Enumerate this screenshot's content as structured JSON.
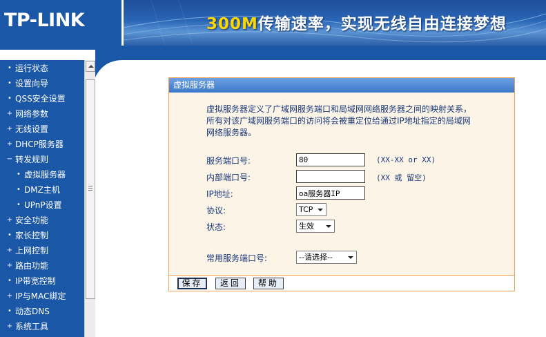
{
  "header": {
    "logo": "TP-LINK",
    "slogan_highlight": "300M",
    "slogan_rest": "传输速率，实现无线自由连接梦想"
  },
  "sidebar": {
    "items": [
      {
        "label": "运行状态",
        "bullet": "•",
        "level": 1
      },
      {
        "label": "设置向导",
        "bullet": "•",
        "level": 1
      },
      {
        "label": "QSS安全设置",
        "bullet": "•",
        "level": 1
      },
      {
        "label": "网络参数",
        "bullet": "+",
        "level": 1
      },
      {
        "label": "无线设置",
        "bullet": "+",
        "level": 1
      },
      {
        "label": "DHCP服务器",
        "bullet": "+",
        "level": 1
      },
      {
        "label": "转发规则",
        "bullet": "−",
        "level": 1
      },
      {
        "label": "虚拟服务器",
        "bullet": "•",
        "level": 2
      },
      {
        "label": "DMZ主机",
        "bullet": "•",
        "level": 2
      },
      {
        "label": "UPnP设置",
        "bullet": "•",
        "level": 2
      },
      {
        "label": "安全功能",
        "bullet": "+",
        "level": 1
      },
      {
        "label": "家长控制",
        "bullet": "•",
        "level": 1
      },
      {
        "label": "上网控制",
        "bullet": "+",
        "level": 1
      },
      {
        "label": "路由功能",
        "bullet": "+",
        "level": 1
      },
      {
        "label": "IP带宽控制",
        "bullet": "•",
        "level": 1
      },
      {
        "label": "IP与MAC绑定",
        "bullet": "+",
        "level": 1
      },
      {
        "label": "动态DNS",
        "bullet": "•",
        "level": 1
      },
      {
        "label": "系统工具",
        "bullet": "+",
        "level": 1
      }
    ]
  },
  "panel": {
    "title": "虚拟服务器",
    "description_lines": [
      "虚拟服务器定义了广域网服务端口和局域网网络服务器之间的映射关系，",
      "所有对该广域网服务端口的访问将会被重定位给通过IP地址指定的局域网",
      "网络服务器。"
    ],
    "fields": {
      "service_port": {
        "label": "服务端口号:",
        "value": "80",
        "hint": "(XX-XX or XX)"
      },
      "internal_port": {
        "label": "内部端口号:",
        "value": "",
        "hint": "(XX 或 留空)"
      },
      "ip_address": {
        "label": "IP地址:",
        "value": "oa服务器IP"
      },
      "protocol": {
        "label": "协议:",
        "value": "TCP"
      },
      "status": {
        "label": "状态:",
        "value": "生效"
      },
      "common_port": {
        "label": "常用服务端口号:",
        "value": "--请选择--"
      }
    },
    "buttons": {
      "save": "保存",
      "back": "返回",
      "help": "帮助"
    }
  },
  "colors": {
    "brand_blue": "#1a57a6",
    "panel_border": "#f0a050",
    "panel_bg": "#fdf4e8",
    "text": "#1a3a7a"
  }
}
